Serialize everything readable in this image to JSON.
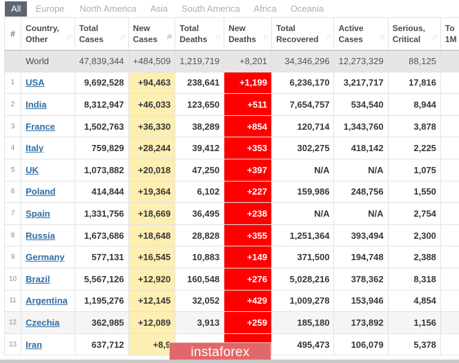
{
  "tabs": [
    {
      "label": "All",
      "active": true
    },
    {
      "label": "Europe",
      "active": false
    },
    {
      "label": "North America",
      "active": false
    },
    {
      "label": "Asia",
      "active": false
    },
    {
      "label": "South America",
      "active": false
    },
    {
      "label": "Africa",
      "active": false
    },
    {
      "label": "Oceania",
      "active": false
    }
  ],
  "table": {
    "headers": [
      {
        "line1": "#",
        "line2": ""
      },
      {
        "line1": "Country,",
        "line2": "Other"
      },
      {
        "line1": "Total",
        "line2": "Cases"
      },
      {
        "line1": "New",
        "line2": "Cases"
      },
      {
        "line1": "Total",
        "line2": "Deaths"
      },
      {
        "line1": "New",
        "line2": "Deaths"
      },
      {
        "line1": "Total",
        "line2": "Recovered"
      },
      {
        "line1": "Active",
        "line2": "Cases"
      },
      {
        "line1": "Serious,",
        "line2": "Critical"
      },
      {
        "line1": "To",
        "line2": "1M"
      }
    ],
    "sort_icon": "sort-icon",
    "active_sort_column": "New Cases",
    "world": {
      "country": "World",
      "total_cases": "47,839,344",
      "new_cases": "+484,509",
      "total_deaths": "1,219,719",
      "new_deaths": "+8,201",
      "total_recovered": "34,346,296",
      "active_cases": "12,273,329",
      "serious_critical": "88,125"
    },
    "rows": [
      {
        "idx": "1",
        "country": "USA",
        "total_cases": "9,692,528",
        "new_cases": "+94,463",
        "total_deaths": "238,641",
        "new_deaths": "+1,199",
        "total_recovered": "6,236,170",
        "active_cases": "3,217,717",
        "serious_critical": "17,816"
      },
      {
        "idx": "2",
        "country": "India",
        "total_cases": "8,312,947",
        "new_cases": "+46,033",
        "total_deaths": "123,650",
        "new_deaths": "+511",
        "total_recovered": "7,654,757",
        "active_cases": "534,540",
        "serious_critical": "8,944"
      },
      {
        "idx": "3",
        "country": "France",
        "total_cases": "1,502,763",
        "new_cases": "+36,330",
        "total_deaths": "38,289",
        "new_deaths": "+854",
        "total_recovered": "120,714",
        "active_cases": "1,343,760",
        "serious_critical": "3,878"
      },
      {
        "idx": "4",
        "country": "Italy",
        "total_cases": "759,829",
        "new_cases": "+28,244",
        "total_deaths": "39,412",
        "new_deaths": "+353",
        "total_recovered": "302,275",
        "active_cases": "418,142",
        "serious_critical": "2,225"
      },
      {
        "idx": "5",
        "country": "UK",
        "total_cases": "1,073,882",
        "new_cases": "+20,018",
        "total_deaths": "47,250",
        "new_deaths": "+397",
        "total_recovered": "N/A",
        "active_cases": "N/A",
        "serious_critical": "1,075"
      },
      {
        "idx": "6",
        "country": "Poland",
        "total_cases": "414,844",
        "new_cases": "+19,364",
        "total_deaths": "6,102",
        "new_deaths": "+227",
        "total_recovered": "159,986",
        "active_cases": "248,756",
        "serious_critical": "1,550"
      },
      {
        "idx": "7",
        "country": "Spain",
        "total_cases": "1,331,756",
        "new_cases": "+18,669",
        "total_deaths": "36,495",
        "new_deaths": "+238",
        "total_recovered": "N/A",
        "active_cases": "N/A",
        "serious_critical": "2,754"
      },
      {
        "idx": "8",
        "country": "Russia",
        "total_cases": "1,673,686",
        "new_cases": "+18,648",
        "total_deaths": "28,828",
        "new_deaths": "+355",
        "total_recovered": "1,251,364",
        "active_cases": "393,494",
        "serious_critical": "2,300"
      },
      {
        "idx": "9",
        "country": "Germany",
        "total_cases": "577,131",
        "new_cases": "+16,545",
        "total_deaths": "10,883",
        "new_deaths": "+149",
        "total_recovered": "371,500",
        "active_cases": "194,748",
        "serious_critical": "2,388"
      },
      {
        "idx": "10",
        "country": "Brazil",
        "total_cases": "5,567,126",
        "new_cases": "+12,920",
        "total_deaths": "160,548",
        "new_deaths": "+276",
        "total_recovered": "5,028,216",
        "active_cases": "378,362",
        "serious_critical": "8,318"
      },
      {
        "idx": "11",
        "country": "Argentina",
        "total_cases": "1,195,276",
        "new_cases": "+12,145",
        "total_deaths": "32,052",
        "new_deaths": "+429",
        "total_recovered": "1,009,278",
        "active_cases": "153,946",
        "serious_critical": "4,854"
      },
      {
        "idx": "12",
        "country": "Czechia",
        "total_cases": "362,985",
        "new_cases": "+12,089",
        "total_deaths": "3,913",
        "new_deaths": "+259",
        "total_recovered": "185,180",
        "active_cases": "173,892",
        "serious_critical": "1,156"
      },
      {
        "idx": "13",
        "country": "Iran",
        "total_cases": "637,712",
        "new_cases": "+8,9",
        "total_deaths": "",
        "new_deaths": "",
        "total_recovered": "495,473",
        "active_cases": "106,079",
        "serious_critical": "5,378"
      }
    ]
  },
  "watermark": {
    "text": "instaforex"
  },
  "colors": {
    "tab_active_bg": "#5c6670",
    "new_cases_bg": "#fdeeb1",
    "new_deaths_bg": "#fe0000",
    "world_row_bg": "#e6e6e6",
    "link": "#2e6ea6",
    "watermark_bg": "#e0686a"
  }
}
